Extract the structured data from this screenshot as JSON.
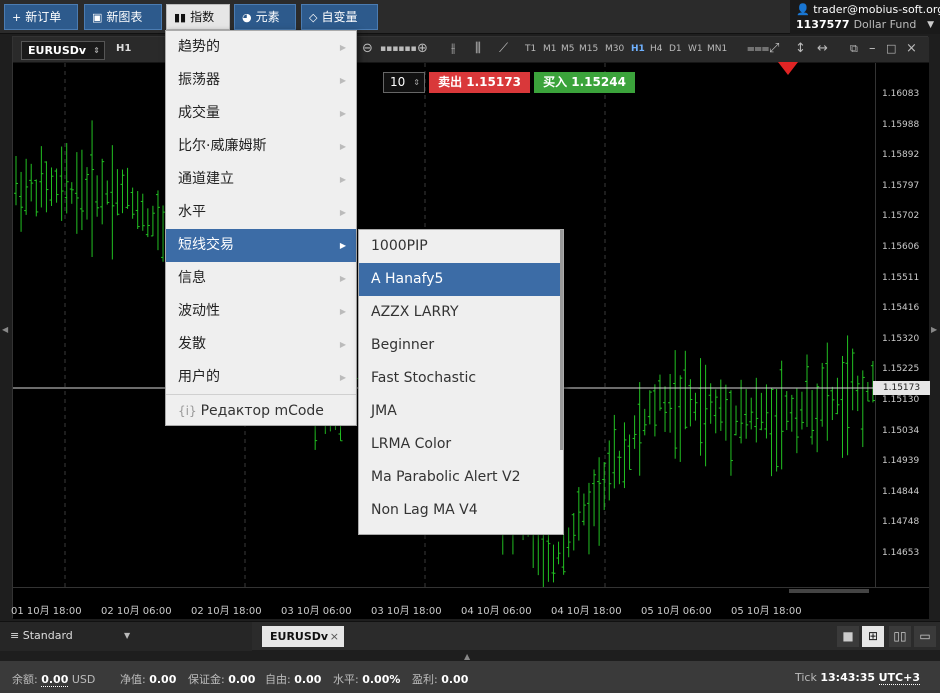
{
  "toolbar": {
    "new_order": "新订单",
    "new_chart": "新图表",
    "indicators": "指数",
    "elements": "元素",
    "variables": "自变量"
  },
  "account": {
    "user": "trader@mobius-soft.org",
    "number": "1137577",
    "fund": "Dollar Fund"
  },
  "chart": {
    "symbol": "EURUSDv",
    "timeframe": "H1",
    "timeframes": [
      "T1",
      "M1",
      "M5",
      "M15",
      "M30",
      "H1",
      "H4",
      "D1",
      "W1",
      "MN1"
    ],
    "selected_timeframe": "H1",
    "lot": "10",
    "sell_label": "卖出 1.15173",
    "buy_label": "买入 1.15244",
    "current_price": "1.15173",
    "price_ticks": [
      "1.16083",
      "1.15988",
      "1.15892",
      "1.15797",
      "1.15702",
      "1.15606",
      "1.15511",
      "1.15416",
      "1.15320",
      "1.15225",
      "1.15130",
      "1.15034",
      "1.14939",
      "1.14844",
      "1.14748",
      "1.14653"
    ],
    "time_ticks": [
      "01 10月 18:00",
      "02 10月 06:00",
      "02 10月 18:00",
      "03 10月 06:00",
      "03 10月 18:00",
      "04 10月 06:00",
      "04 10月 18:00",
      "05 10月 06:00",
      "05 10月 18:00"
    ],
    "colors": {
      "bar": "#22c022",
      "sell": "#d9383a",
      "buy": "#3ba33b"
    }
  },
  "chart_data": {
    "type": "ohlc",
    "title": "",
    "xlabel": "",
    "ylabel": "",
    "ylim": [
      1.146,
      1.1615
    ],
    "last_price": 1.15173,
    "x": [
      "01 10月 18:00",
      "02 10月 06:00",
      "02 10月 18:00",
      "03 10月 06:00",
      "03 10月 18:00",
      "04 10月 06:00",
      "04 10月 18:00",
      "05 10月 06:00",
      "05 10月 18:00"
    ],
    "close": [
      1.1578,
      1.1577,
      1.1545,
      1.1513,
      1.1516,
      1.1467,
      1.1515,
      1.151,
      1.1518
    ]
  },
  "main_menu": [
    {
      "label": "趋势的",
      "sub": "▶"
    },
    {
      "label": "振荡器",
      "sub": "▶"
    },
    {
      "label": "成交量",
      "sub": "▶"
    },
    {
      "label": "比尔·威廉姆斯",
      "sub": "▶"
    },
    {
      "label": "通道建立",
      "sub": "▶"
    },
    {
      "label": "水平",
      "sub": "▶"
    },
    {
      "label": "短线交易",
      "sub": "▶"
    },
    {
      "label": "信息",
      "sub": "▶"
    },
    {
      "label": "波动性",
      "sub": "▶"
    },
    {
      "label": "发散",
      "sub": "▶"
    },
    {
      "label": "用户的",
      "sub": "▶"
    }
  ],
  "mcode_editor": "Редактор mCode",
  "sub_menu": [
    "1000PIP",
    "A Hanafy5",
    "AZZX LARRY",
    "Beginner",
    "Fast Stochastic",
    "JMA",
    "LRMA Color",
    "Ma Parabolic Alert V2",
    "Non Lag MA V4"
  ],
  "bottom": {
    "workspace": "Standard",
    "chart_tab": "EURUSDv"
  },
  "status": {
    "balance_label": "余额:",
    "balance": "0.00",
    "currency": "USD",
    "equity_label": "净值:",
    "equity": "0.00",
    "margin_label": "保证金:",
    "margin": "0.00",
    "free_label": "自由:",
    "free": "0.00",
    "level_label": "水平:",
    "level": "0.00%",
    "profit_label": "盈利:",
    "profit": "0.00",
    "tick_label": "Tick",
    "time": "13:43:35",
    "tz": "UTC+3"
  }
}
